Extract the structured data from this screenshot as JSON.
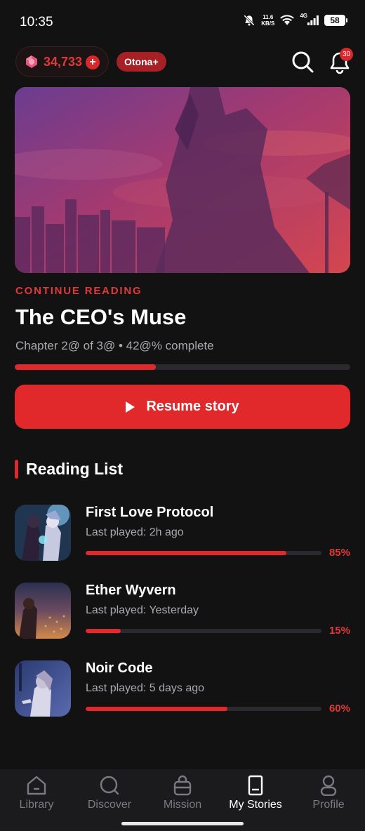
{
  "status_bar": {
    "time": "10:35",
    "net_speed_value": "11.6",
    "net_speed_unit": "KB/S",
    "network_type": "4G",
    "battery": "58"
  },
  "header": {
    "coins": "34,733",
    "coin_plus": "+",
    "badge": "Otona+",
    "notification_count": "30"
  },
  "continue_reading": {
    "label": "CONTINUE READING",
    "title": "The CEO's Muse",
    "meta": "Chapter 2@ of 3@ • 42@% complete",
    "progress": 0.42,
    "resume_label": "Resume story"
  },
  "reading_list": {
    "title": "Reading List",
    "items": [
      {
        "title": "First Love Protocol",
        "last_played": "Last played: 2h ago",
        "progress": 0.85,
        "percent": "85%"
      },
      {
        "title": "Ether Wyvern",
        "last_played": "Last played: Yesterday",
        "progress": 0.15,
        "percent": "15%"
      },
      {
        "title": "Noir Code",
        "last_played": "Last played: 5 days ago",
        "progress": 0.6,
        "percent": "60%"
      }
    ]
  },
  "bottom_nav": [
    {
      "label": "Library",
      "icon": "home-icon",
      "active": false
    },
    {
      "label": "Discover",
      "icon": "search-icon",
      "active": false
    },
    {
      "label": "Mission",
      "icon": "bag-icon",
      "active": false
    },
    {
      "label": "My Stories",
      "icon": "book-icon",
      "active": true
    },
    {
      "label": "Profile",
      "icon": "person-icon",
      "active": false
    }
  ],
  "colors": {
    "accent": "#e1282a",
    "background": "#121212",
    "muted_text": "#a9a9b0"
  }
}
